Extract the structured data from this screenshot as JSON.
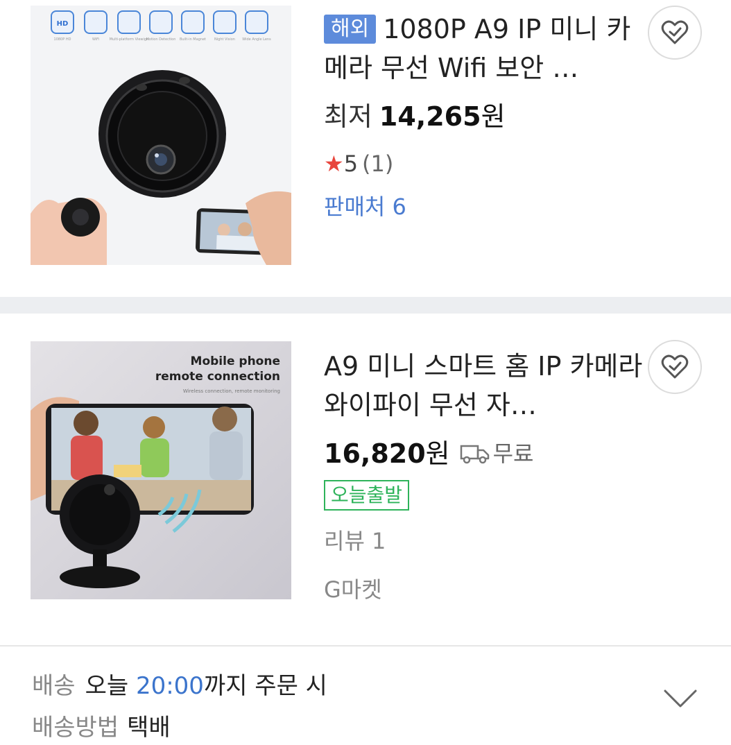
{
  "products": [
    {
      "overseas_badge": "해외",
      "title": "1080P A9 IP 미니 카메라 무선 Wifi 보안 …",
      "price_prefix": "최저",
      "price": "14,265",
      "price_unit": "원",
      "rating": "5",
      "rating_count": "(1)",
      "sellers": "판매처 6",
      "feature_icons": [
        "1080P HD",
        "WiFi",
        "Multi-platform Viewign",
        "Motion Detection",
        "Built-in Magnet",
        "Night Vision",
        "Wide Angle Lens"
      ]
    },
    {
      "title": "A9 미니 스마트 홈 IP 카메라 와이파이 무선 자…",
      "price": "16,820",
      "price_unit": "원",
      "shipping": "무료",
      "today_badge": "오늘출발",
      "reviews": "리뷰 1",
      "seller": "G마켓",
      "image_heading_1": "Mobile phone",
      "image_heading_2": "remote connection",
      "image_subheading": "Wireless connection, remote monitoring"
    }
  ],
  "delivery": {
    "label": "배송",
    "text_pre": "오늘",
    "time": "20:00",
    "text_post": "까지 주문 시",
    "method_label": "배송방법",
    "method_value": "택배"
  },
  "colors": {
    "overseas_badge": "#5d8bdb",
    "star": "#e8453c",
    "sellers_link": "#4a7bd0",
    "today_badge": "#2eb35a",
    "separator": "#eceef1"
  }
}
